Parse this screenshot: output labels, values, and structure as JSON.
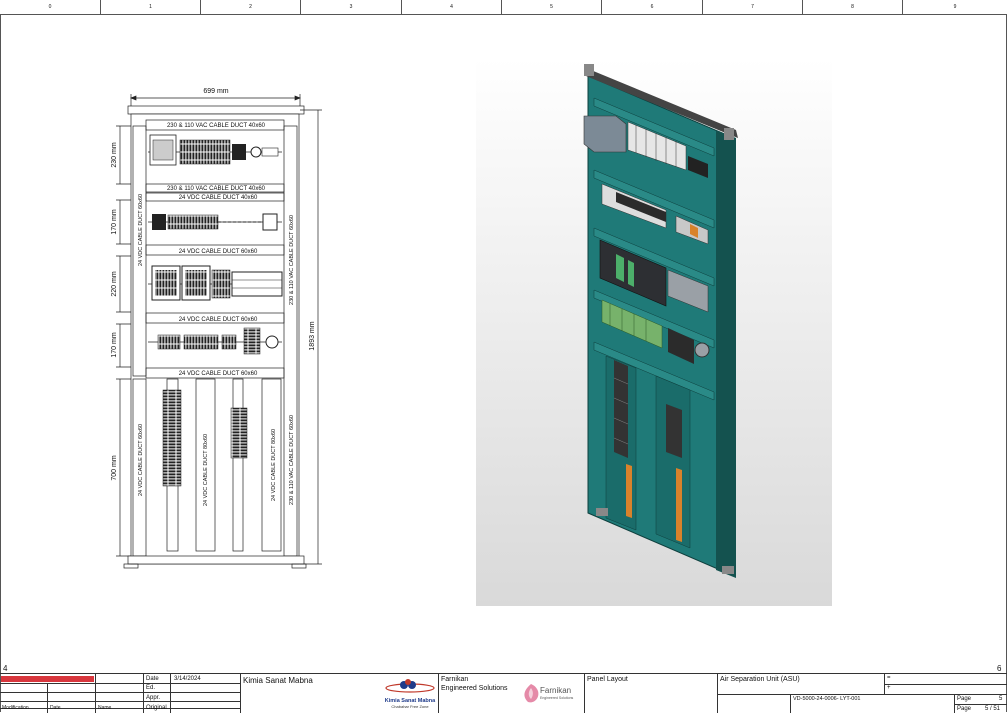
{
  "ruler": {
    "numbers": [
      "0",
      "1",
      "2",
      "3",
      "4",
      "5",
      "6",
      "7",
      "8",
      "9"
    ]
  },
  "corner": {
    "left": "4",
    "right": "6"
  },
  "dims": {
    "width": "699 mm",
    "height": "1893 mm",
    "row1": "230 mm",
    "row2": "170 mm",
    "row3": "220 mm",
    "row4": "170 mm",
    "row5": "700 mm"
  },
  "ducts": {
    "top_a": "230 & 110 VAC CABLE DUCT 40x60",
    "top_b": "230 & 110 VAC CABLE DUCT 40x60",
    "dc_40": "24 VDC CABLE DUCT 40x60",
    "dc_60_a": "24 VDC CABLE DUCT 60x60",
    "dc_60_b": "24 VDC CABLE DUCT 60x60",
    "dc_60_c": "24 VDC CABLE DUCT 60x60",
    "v_left_top": "24 VDC CABLE DUCT 60x60",
    "v_right_top": "230 & 110 VAC CABLE DUCT 60x60",
    "v_left_bottom": "24 VDC CABLE DUCT 60x60",
    "v_mid_bottom": "24 VDC CABLE DUCT 80x60",
    "v_mid2_bottom": "24 VDC CABLE DUCT 80x60",
    "v_right_bottom": "230 & 110 VAC CABLE DUCT 60x60"
  },
  "title_block": {
    "col_headers": [
      "Modification",
      "Date",
      "Name"
    ],
    "date_label": "Date",
    "date_value": "3/14/2024",
    "ed_label": "Ed.",
    "appr_label": "Appr.",
    "original_label": "Original",
    "client": "Kimia Sanat Mabna",
    "client_logo_name": "Kimia Sanat Mabna",
    "client_logo_sub": "Chabahar Free Zone",
    "contractor_line1": "Farnikan",
    "contractor_line2": "Engineered Solutions",
    "contractor_logo_name": "Farnikan",
    "contractor_logo_sub": "Engineered Solutions",
    "drawing_title": "Panel Layout",
    "project": "Air Separation Unit (ASU)",
    "plus_eq": "=",
    "plus_loc": "+",
    "doc_number": "VD-5000-24-0006- LYT-001",
    "page_label": "Page",
    "page_value": "5",
    "page_total_label": "Page",
    "page_total_value": "5 / 51"
  },
  "colors": {
    "panel": "#1f7a78",
    "panel_dark": "#14524f",
    "redbar": "#d8363d",
    "orange": "#d9822b"
  }
}
